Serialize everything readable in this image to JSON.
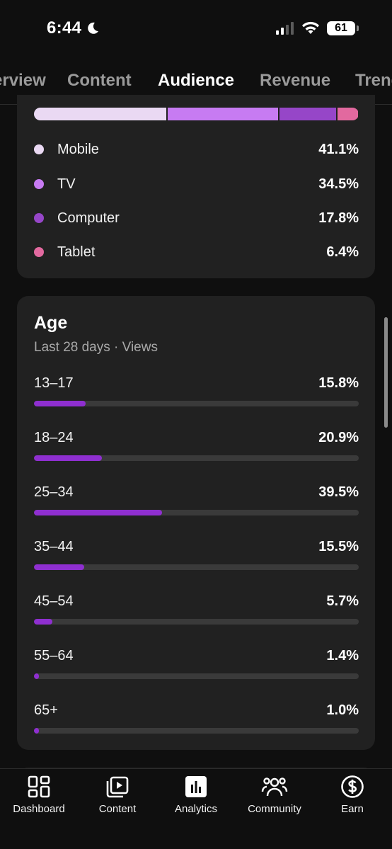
{
  "status_bar": {
    "time": "6:44",
    "battery": "61"
  },
  "tabs": [
    {
      "label": "Overview"
    },
    {
      "label": "Content"
    },
    {
      "label": "Audience"
    },
    {
      "label": "Revenue"
    },
    {
      "label": "Trends"
    }
  ],
  "device_type": {
    "segments_colors": [
      "#ead9f3",
      "#c77bf2",
      "#9646c8",
      "#e2699f"
    ],
    "items": [
      {
        "label": "Mobile",
        "value": "41.1%",
        "color": "#ead9f3"
      },
      {
        "label": "TV",
        "value": "34.5%",
        "color": "#c77bf2"
      },
      {
        "label": "Computer",
        "value": "17.8%",
        "color": "#9646c8"
      },
      {
        "label": "Tablet",
        "value": "6.4%",
        "color": "#e2699f"
      }
    ]
  },
  "age": {
    "title": "Age",
    "subtitle": "Last 28 days · Views",
    "bar_color": "#8f2fd0",
    "rows": [
      {
        "label": "13–17",
        "value": "15.8%",
        "pct": 15.8
      },
      {
        "label": "18–24",
        "value": "20.9%",
        "pct": 20.9
      },
      {
        "label": "25–34",
        "value": "39.5%",
        "pct": 39.5
      },
      {
        "label": "35–44",
        "value": "15.5%",
        "pct": 15.5
      },
      {
        "label": "45–54",
        "value": "5.7%",
        "pct": 5.7
      },
      {
        "label": "55–64",
        "value": "1.4%",
        "pct": 1.4
      },
      {
        "label": "65+",
        "value": "1.0%",
        "pct": 1.0
      }
    ]
  },
  "bottom_nav": [
    {
      "label": "Dashboard",
      "icon": "dashboard-icon"
    },
    {
      "label": "Content",
      "icon": "content-icon"
    },
    {
      "label": "Analytics",
      "icon": "analytics-icon"
    },
    {
      "label": "Community",
      "icon": "community-icon"
    },
    {
      "label": "Earn",
      "icon": "earn-icon"
    }
  ]
}
